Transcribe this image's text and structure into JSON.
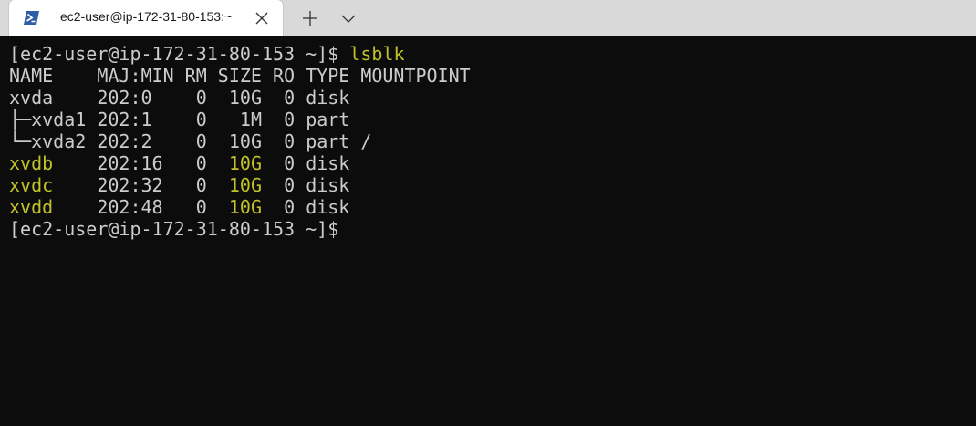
{
  "tab": {
    "icon": "powershell-icon",
    "title": "ec2-user@ip-172-31-80-153:~"
  },
  "toolbar": {
    "new_tab_icon": "plus-icon",
    "dropdown_icon": "chevron-down-icon",
    "close_icon": "close-icon"
  },
  "colors": {
    "terminal_bg": "#0c0c0c",
    "text": "#cccccc",
    "highlight": "#c1c129",
    "titlebar": "#d9d9d9"
  },
  "terminal": {
    "prompt": "[ec2-user@ip-172-31-80-153 ~]$",
    "command": "lsblk",
    "header": "NAME    MAJ:MIN RM SIZE RO TYPE MOUNTPOINT",
    "rows": [
      {
        "name": "xvda",
        "majmin": "202:0",
        "rm": "0",
        "size": "10G",
        "ro": "0",
        "type": "disk",
        "mount": ""
      },
      {
        "name": "├─xvda1",
        "majmin": "202:1",
        "rm": "0",
        "size": "1M",
        "ro": "0",
        "type": "part",
        "mount": ""
      },
      {
        "name": "└─xvda2",
        "majmin": "202:2",
        "rm": "0",
        "size": "10G",
        "ro": "0",
        "type": "part",
        "mount": "/"
      },
      {
        "name": "xvdb",
        "majmin": "202:16",
        "rm": "0",
        "size": "10G",
        "ro": "0",
        "type": "disk",
        "mount": ""
      },
      {
        "name": "xvdc",
        "majmin": "202:32",
        "rm": "0",
        "size": "10G",
        "ro": "0",
        "type": "disk",
        "mount": ""
      },
      {
        "name": "xvdd",
        "majmin": "202:48",
        "rm": "0",
        "size": "10G",
        "ro": "0",
        "type": "disk",
        "mount": ""
      }
    ],
    "final_prompt": "[ec2-user@ip-172-31-80-153 ~]$"
  }
}
